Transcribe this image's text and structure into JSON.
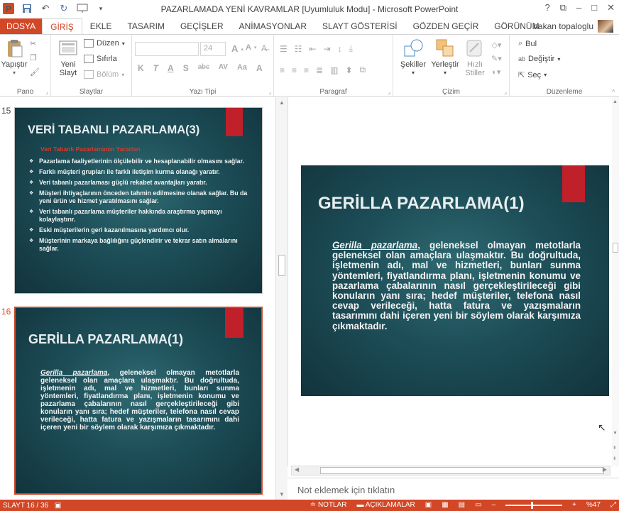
{
  "window": {
    "title": "PAZARLAMADA YENİ KAVRAMLAR [Uyumluluk Modu] - Microsoft PowerPoint",
    "app_icon": "P",
    "controls": [
      "?",
      "⧉",
      "–",
      "□",
      "✕"
    ]
  },
  "user": {
    "name": "hakan topaloglu"
  },
  "tabs": [
    {
      "label": "DOSYA"
    },
    {
      "label": "GİRİŞ"
    },
    {
      "label": "EKLE"
    },
    {
      "label": "TASARIM"
    },
    {
      "label": "GEÇİŞLER"
    },
    {
      "label": "ANİMASYONLAR"
    },
    {
      "label": "SLAYT GÖSTERİSİ"
    },
    {
      "label": "GÖZDEN GEÇİR"
    },
    {
      "label": "GÖRÜNÜM"
    }
  ],
  "ribbon": {
    "pano": {
      "label": "Pano",
      "paste": "Yapıştır"
    },
    "slaytlar": {
      "label": "Slaytlar",
      "new_slide_1": "Yeni",
      "new_slide_2": "Slayt",
      "layout": "Düzen",
      "reset": "Sıfırla",
      "section": "Bölüm"
    },
    "yazitipi": {
      "label": "Yazı Tipi",
      "font_size": "24",
      "bold": "K",
      "italic": "T",
      "underline": "A",
      "shadow": "S",
      "strike": "abc",
      "spacing": "AV",
      "case": "Aa",
      "color": "A"
    },
    "paragraf": {
      "label": "Paragraf"
    },
    "cizim": {
      "label": "Çizim",
      "shapes": "Şekiller",
      "arrange": "Yerleştir",
      "quick_styles_1": "Hızlı",
      "quick_styles_2": "Stiller"
    },
    "duzenleme": {
      "label": "Düzenleme",
      "find": "Bul",
      "replace": "Değiştir",
      "select": "Seç"
    }
  },
  "thumbnails": [
    {
      "number": "15",
      "title": "VERİ TABANLI PAZARLAMA(3)",
      "subtitle": "Veri Tabanlı Pazarlamanın Yararları",
      "bullets": [
        "Pazarlama faaliyetlerinin ölçülebilir ve hesaplanabilir olmasını sağlar.",
        "Farklı müşteri grupları ile farklı iletişim kurma olanağı yaratır.",
        "Veri tabanlı pazarlaması güçlü rekabet avantajları yaratır.",
        "Müşteri ihtiyaçlarının önceden tahmin edilmesine olanak sağlar. Bu da yeni ürün ve hizmet yaratılmasını sağlar.",
        "Veri tabanlı pazarlama müşteriler hakkında araştırma yapmayı kolaylaştırır.",
        "Eski müşterilerin geri kazanılmasına yardımcı olur.",
        "Müşterinin markaya bağlılığını güçlendirir ve tekrar satın almalarını sağlar."
      ]
    },
    {
      "number": "16",
      "title": "GERİLLA PAZARLAMA(1)"
    }
  ],
  "slide": {
    "title": "GERİLLA PAZARLAMA(1)",
    "term": "Gerilla pazarlama",
    "body": ", geleneksel olmayan metotlarla geleneksel olan amaçlara ulaşmaktır. Bu doğrultuda, işletmenin adı, mal ve hizmetleri, bunları sunma yöntemleri, fiyatlandırma planı, işletmenin konumu ve pazarlama çabalarının nasıl gerçekleştirileceği gibi konuların yanı sıra; hedef müşteriler, telefona nasıl cevap verileceği, hatta fatura ve yazışmaların tasarımını dahi içeren yeni bir söylem olarak karşımıza çıkmaktadır."
  },
  "notes": {
    "placeholder": "Not eklemek için tıklatın"
  },
  "status": {
    "slide_info": "SLAYT 16 / 36",
    "notes": "NOTLAR",
    "comments": "AÇIKLAMALAR",
    "zoom": "%47"
  },
  "colors": {
    "accent": "#d24726",
    "slide_bg": "#1d4e58",
    "slide_redbar": "#c0202a"
  }
}
